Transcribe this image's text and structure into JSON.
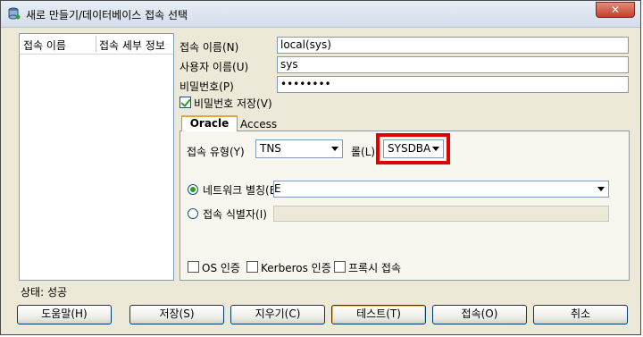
{
  "window": {
    "title": "새로 만들기/데이터베이스 접속 선택",
    "close": "✕"
  },
  "list": {
    "col1": "접속 이름",
    "col2": "접속 세부 정보"
  },
  "form": {
    "conn_name_label": "접속 이름(N)",
    "conn_name_value": "local(sys)",
    "user_label": "사용자 이름(U)",
    "user_value": "sys",
    "password_label": "비밀번호(P)",
    "password_value": "••••••••",
    "save_password_label": "비밀번호 저장(V)"
  },
  "tabs": {
    "oracle": "Oracle",
    "access": "Access"
  },
  "oracle": {
    "conn_type_label": "접속 유형(Y)",
    "conn_type_value": "TNS",
    "role_label": "롤(L)",
    "role_value": "SYSDBA",
    "network_alias_label": "네트워크 별칭(E)",
    "network_alias_value": "E",
    "conn_identifier_label": "접속 식별자(I)",
    "os_auth": "OS 인증",
    "kerberos_auth": "Kerberos 인증",
    "proxy_conn": "프록시 접속"
  },
  "status": "상태: 성공",
  "buttons": {
    "help": "도움말(H)",
    "save": "저장(S)",
    "clear": "지우기(C)",
    "test": "테스트(T)",
    "connect": "접속(O)",
    "cancel": "취소"
  }
}
